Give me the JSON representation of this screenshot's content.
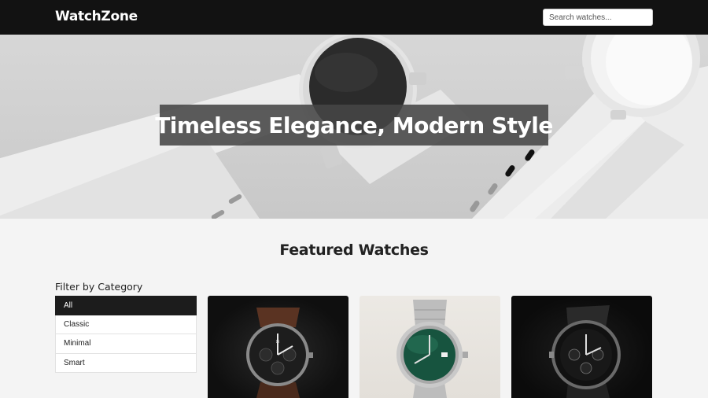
{
  "header": {
    "logo": "WatchZone",
    "search_placeholder": "Search watches..."
  },
  "hero": {
    "title": "Timeless Elegance, Modern Style"
  },
  "featured": {
    "title": "Featured Watches"
  },
  "filter": {
    "title": "Filter by Category",
    "items": [
      {
        "label": "All",
        "active": true
      },
      {
        "label": "Classic",
        "active": false
      },
      {
        "label": "Minimal",
        "active": false
      },
      {
        "label": "Smart",
        "active": false
      }
    ]
  },
  "products": [
    {
      "image": "pilot-chronograph-watch-photo",
      "dial_color": "#1d1d1d",
      "strap_color": "#5a3322"
    },
    {
      "image": "green-dial-steel-watch-photo",
      "dial_color": "#17543f",
      "strap_color": "#b9b9b9"
    },
    {
      "image": "black-chronograph-watch-photo",
      "dial_color": "#141414",
      "strap_color": "#2a2a2a"
    }
  ]
}
